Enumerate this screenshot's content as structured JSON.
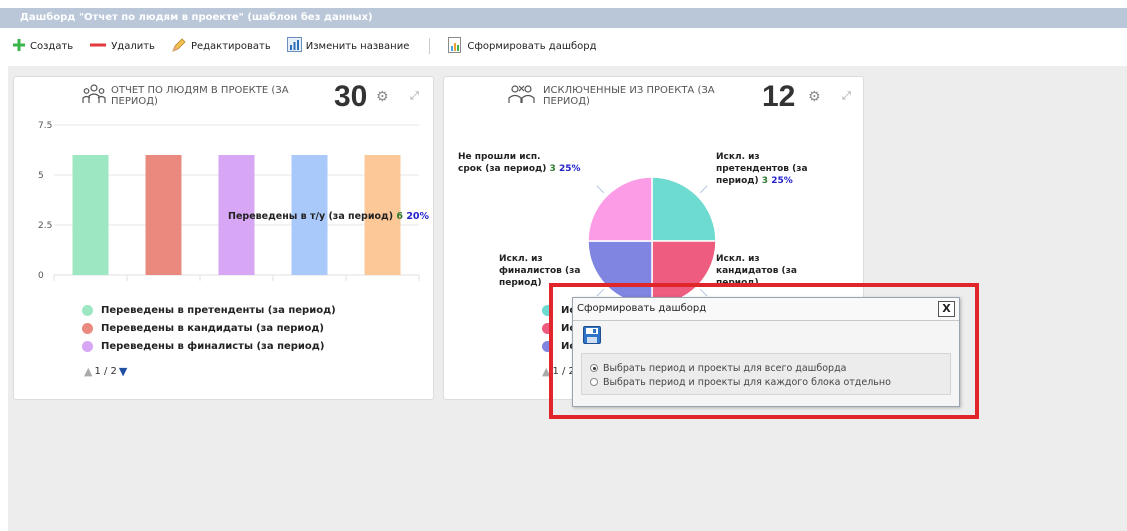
{
  "window": {
    "title": "Дашборд \"Отчет по людям в проекте\" (шаблон без данных)"
  },
  "toolbar": {
    "create": "Создать",
    "delete": "Удалить",
    "edit": "Редактировать",
    "rename": "Изменить название",
    "build": "Сформировать дашборд"
  },
  "card1": {
    "title_line1": "ОТЧЕТ ПО ЛЮДЯМ В ПРОЕКТЕ (ЗА",
    "title_line2": "ПЕРИОД)",
    "count": "30",
    "tooltip": {
      "label": "Переведены в т/у (за период)",
      "num": "6",
      "pct": "20%"
    },
    "legend": [
      {
        "label": "Переведены в претенденты (за период)",
        "color": "#9de8c2"
      },
      {
        "label": "Переведены в кандидаты (за период)",
        "color": "#ea8a7e"
      },
      {
        "label": "Переведены в финалисты (за период)",
        "color": "#d7a6f4"
      }
    ],
    "pager": "1 / 2"
  },
  "card2": {
    "title_line1": "ИСКЛЮЧЕННЫЕ ИЗ ПРОЕКТА (ЗА",
    "title_line2": "ПЕРИОД)",
    "count": "12",
    "labels": {
      "tl": {
        "l1": "Не прошли исп.",
        "l2": "срок (за период)",
        "num": "3",
        "pct": "25%"
      },
      "tr": {
        "l1": "Искл. из",
        "l2": "претендентов (за",
        "l3": "период)",
        "num": "3",
        "pct": "25%"
      },
      "bl": {
        "l1": "Искл. из",
        "l2": "финалистов (за",
        "l3": "период)"
      },
      "br": {
        "l1": "Искл. из",
        "l2": "кандидатов (за",
        "l3": "период)"
      }
    },
    "legend_partial": [
      "Ис",
      "Ис",
      "Ис"
    ],
    "pager_partial": "1 / 2"
  },
  "dialog": {
    "title": "Сформировать дашборд",
    "close": "X",
    "option1": "Выбрать период и проекты для всего дашборда",
    "option2": "Выбрать период и проекты для каждого блока отдельно"
  },
  "chart_data": [
    {
      "type": "bar",
      "categories": [
        "",
        "",
        "",
        "",
        ""
      ],
      "values": [
        6,
        6,
        6,
        6,
        6
      ],
      "colors": [
        "#9de8c2",
        "#ea8a7e",
        "#d7a6f4",
        "#a9c9fb",
        "#fcc898"
      ],
      "ylim": [
        0,
        7.5
      ],
      "yticks": [
        "7.5",
        "5",
        "2.5",
        "0"
      ],
      "grid": true
    },
    {
      "type": "pie",
      "values": [
        3,
        3,
        3,
        3
      ],
      "colors": [
        "#6edbd1",
        "#ee5c80",
        "#8185e2",
        "#fc9ce6"
      ]
    }
  ]
}
